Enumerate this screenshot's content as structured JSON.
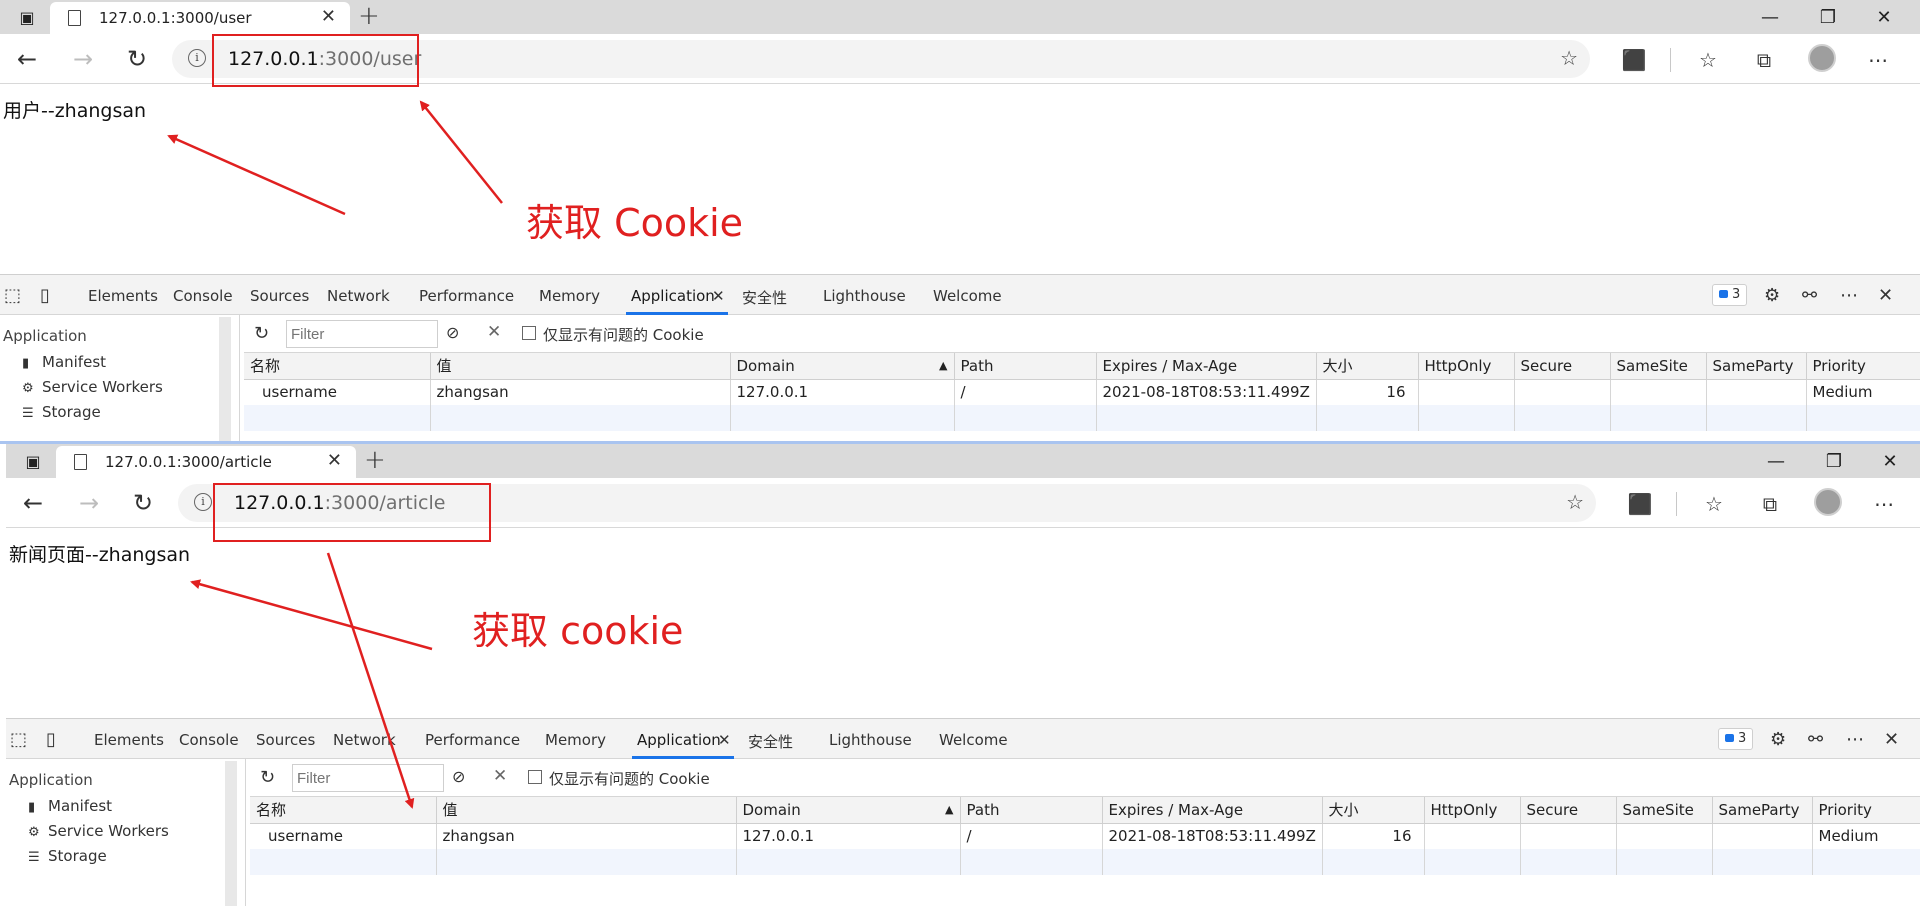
{
  "browsers": [
    {
      "tab_title": "127.0.0.1:3000/user",
      "url_host": "127.0.0.1",
      "url_path": ":3000/user",
      "page_text": "用户--zhangsan",
      "annotation": "获取 Cookie"
    },
    {
      "tab_title": "127.0.0.1:3000/article",
      "url_host": "127.0.0.1",
      "url_path": ":3000/article",
      "page_text": "新闻页面--zhangsan",
      "annotation": "获取 cookie"
    }
  ],
  "window_controls": {
    "minimize": "—",
    "restore": "❐",
    "close": "✕",
    "new_tab": "+"
  },
  "devtools": {
    "tabs": [
      "Elements",
      "Console",
      "Sources",
      "Network",
      "Performance",
      "Memory",
      "Application",
      "安全性",
      "Lighthouse",
      "Welcome"
    ],
    "active_tab": "Application",
    "issues_count": "3",
    "sidebar": {
      "heading": "Application",
      "items": [
        "Manifest",
        "Service Workers",
        "Storage"
      ]
    },
    "filter_placeholder": "Filter",
    "only_issues_label": "仅显示有问题的 Cookie",
    "columns": [
      "名称",
      "值",
      "Domain",
      "Path",
      "Expires / Max-Age",
      "大小",
      "HttpOnly",
      "Secure",
      "SameSite",
      "SameParty",
      "Priority"
    ],
    "rows": [
      {
        "name": "username",
        "value": "zhangsan",
        "domain": "127.0.0.1",
        "path": "/",
        "expires": "2021-08-18T08:53:11.499Z",
        "size": "16",
        "httponly": "",
        "secure": "",
        "samesite": "",
        "sameparty": "",
        "priority": "Medium"
      }
    ]
  },
  "icons": {
    "back": "back-arrow-icon",
    "forward": "forward-arrow-icon",
    "reload": "reload-icon",
    "info": "info-icon",
    "favorite_add": "add-favorite-icon",
    "extensions": "extensions-icon",
    "favorites": "favorites-icon",
    "collections": "collections-icon",
    "more": "more-icon"
  },
  "colors": {
    "annotation": "#e02020",
    "active_tab_underline": "#1a73e8"
  }
}
